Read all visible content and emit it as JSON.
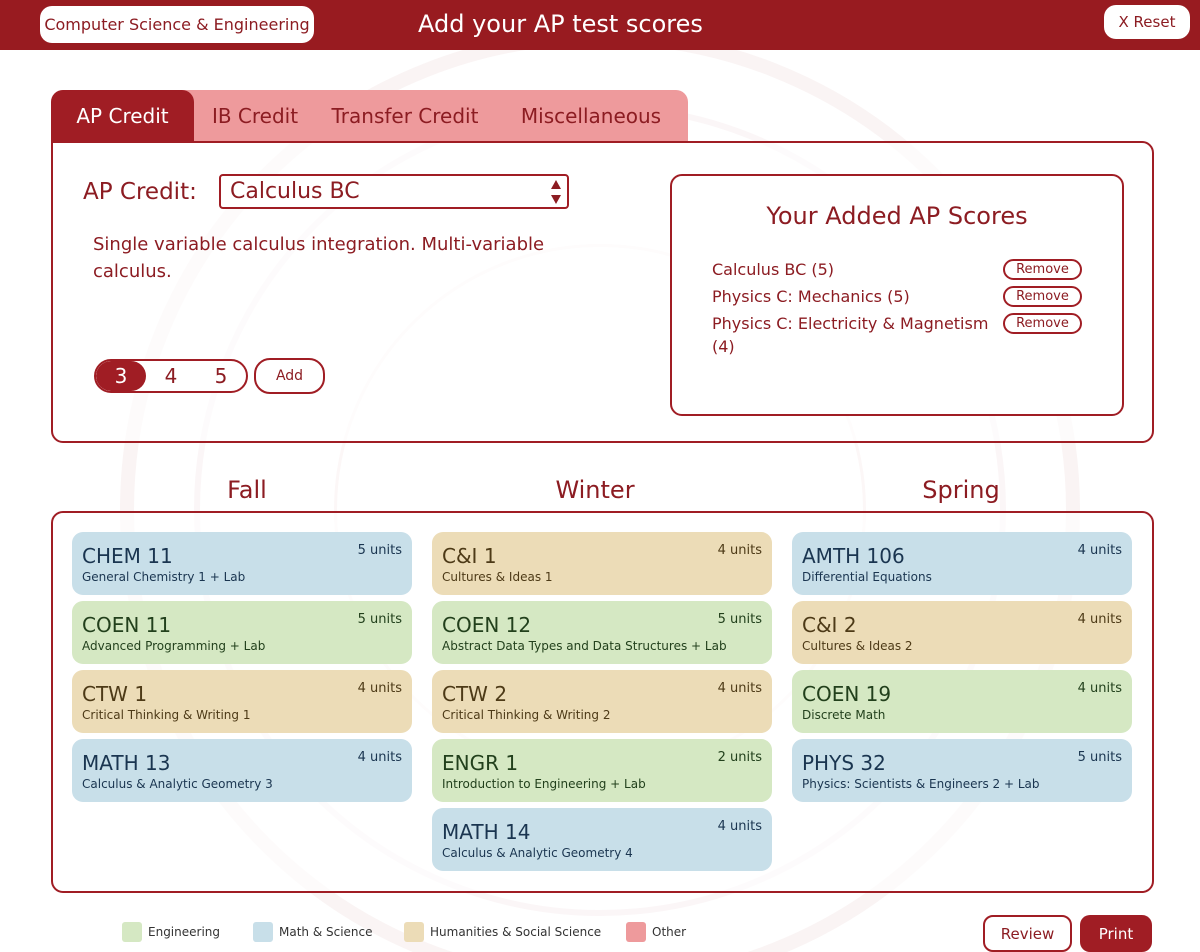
{
  "header": {
    "major": "Computer Science & Engineering",
    "title": "Add your AP test scores",
    "reset_label": "X Reset"
  },
  "tabs": [
    {
      "label": "AP Credit",
      "active": true
    },
    {
      "label": "IB Credit",
      "active": false
    },
    {
      "label": "Transfer Credit",
      "active": false
    },
    {
      "label": "Miscellaneous",
      "active": false
    }
  ],
  "ap_credit": {
    "label": "AP Credit:",
    "selected_exam": "Calculus BC",
    "description": "Single variable calculus integration. Multi-variable calculus.",
    "scores": [
      "3",
      "4",
      "5"
    ],
    "selected_score": "3",
    "add_label": "Add"
  },
  "added_scores": {
    "title": "Your Added AP Scores",
    "remove_label": "Remove",
    "items": [
      {
        "name": "Calculus BC (5)"
      },
      {
        "name": "Physics C: Mechanics (5)"
      },
      {
        "name": "Physics C: Electricity & Magnetism (4)"
      }
    ]
  },
  "quarters": {
    "fall": {
      "title": "Fall",
      "courses": [
        {
          "code": "CHEM 11",
          "name": "General Chemistry 1 + Lab",
          "units": "5 units",
          "category": "math"
        },
        {
          "code": "COEN 11",
          "name": "Advanced Programming + Lab",
          "units": "5 units",
          "category": "eng"
        },
        {
          "code": "CTW 1",
          "name": "Critical Thinking & Writing 1",
          "units": "4 units",
          "category": "hum"
        },
        {
          "code": "MATH 13",
          "name": "Calculus & Analytic Geometry 3",
          "units": "4 units",
          "category": "math"
        }
      ]
    },
    "winter": {
      "title": "Winter",
      "courses": [
        {
          "code": "C&I 1",
          "name": "Cultures & Ideas 1",
          "units": "4 units",
          "category": "hum"
        },
        {
          "code": "COEN 12",
          "name": "Abstract Data Types and Data Structures + Lab",
          "units": "5 units",
          "category": "eng"
        },
        {
          "code": "CTW 2",
          "name": "Critical Thinking & Writing 2",
          "units": "4 units",
          "category": "hum"
        },
        {
          "code": "ENGR 1",
          "name": "Introduction to Engineering + Lab",
          "units": "2 units",
          "category": "eng"
        },
        {
          "code": "MATH 14",
          "name": "Calculus & Analytic Geometry 4",
          "units": "4 units",
          "category": "math"
        }
      ]
    },
    "spring": {
      "title": "Spring",
      "courses": [
        {
          "code": "AMTH 106",
          "name": "Differential Equations",
          "units": "4 units",
          "category": "math"
        },
        {
          "code": "C&I 2",
          "name": "Cultures & Ideas 2",
          "units": "4 units",
          "category": "hum"
        },
        {
          "code": "COEN 19",
          "name": "Discrete Math",
          "units": "4 units",
          "category": "eng"
        },
        {
          "code": "PHYS 32",
          "name": "Physics: Scientists & Engineers 2 + Lab",
          "units": "5 units",
          "category": "math"
        }
      ]
    }
  },
  "legend": [
    {
      "label": "Engineering",
      "color": "#d5e8c3"
    },
    {
      "label": "Math & Science",
      "color": "#c8dfe9"
    },
    {
      "label": "Humanities & Social Science",
      "color": "#ecdcb7"
    },
    {
      "label": "Other",
      "color": "#ee9a9c"
    }
  ],
  "footer": {
    "review_label": "Review",
    "print_label": "Print"
  },
  "colors": {
    "brand": "#981b20",
    "tab_inactive": "#ee9a9c"
  }
}
